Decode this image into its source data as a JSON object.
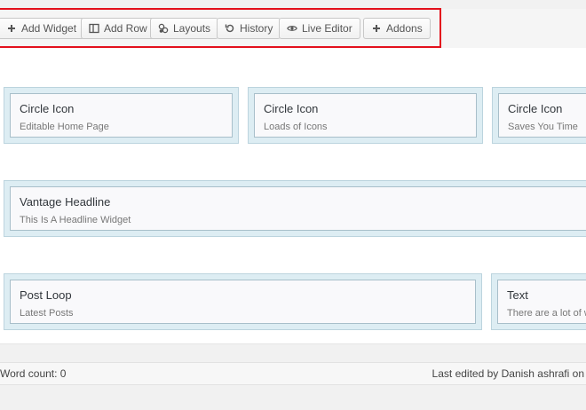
{
  "toolbar": {
    "buttons": [
      {
        "label": "Add Widget",
        "icon": "plus-icon"
      },
      {
        "label": "Add Row",
        "icon": "columns-icon"
      },
      {
        "label": "Layouts",
        "icon": "layouts-icon"
      },
      {
        "label": "History",
        "icon": "history-icon"
      },
      {
        "label": "Live Editor",
        "icon": "eye-icon"
      },
      {
        "label": "Addons",
        "icon": "plus-icon"
      }
    ]
  },
  "rows": [
    {
      "widgets": [
        {
          "title": "Circle Icon",
          "description": "Editable Home Page"
        },
        {
          "title": "Circle Icon",
          "description": "Loads of Icons"
        },
        {
          "title": "Circle Icon",
          "description": "Saves You Time"
        }
      ]
    },
    {
      "widgets": [
        {
          "title": "Vantage Headline",
          "description": "This Is A Headline Widget"
        }
      ]
    },
    {
      "widgets": [
        {
          "title": "Post Loop",
          "description": "Latest Posts"
        },
        {
          "title": "Text",
          "description": "There are a lot of w"
        }
      ]
    }
  ],
  "status": {
    "word_count": "Word count: 0",
    "last_edited": "Last edited by Danish ashrafi on"
  },
  "colors": {
    "highlight": "#e3101c",
    "cell_bg": "#ddedf3",
    "widget_border": "#a8bfca"
  }
}
